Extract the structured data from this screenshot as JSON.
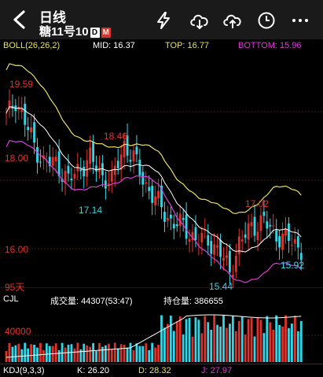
{
  "header": {
    "title": "日线",
    "instrument": "糖11号10",
    "badge_d": "D",
    "badge_m": "M",
    "icons": [
      "back-icon",
      "lightning-icon",
      "cloud-download-icon",
      "cloud-upload-icon",
      "clock-icon",
      "more-icon"
    ]
  },
  "boll": {
    "label": "BOLL(26,26,2)",
    "mid": "MID: 16.37",
    "top": "TOP: 16.77",
    "bottom": "BOTTOM: 15.96"
  },
  "price_axis": {
    "p18": "18.00",
    "p16": "16.00",
    "period": "95天"
  },
  "annotations": {
    "high": "19.59",
    "peak2": "18.46",
    "low1": "17.14",
    "peak3": "17.02",
    "low2": "15.44",
    "last": "15.92"
  },
  "volume": {
    "label": "CJL",
    "volume_text": "成交量: 44307(53:47)",
    "oi_text": "持仓量: 386655",
    "axis": "40000"
  },
  "kdj": {
    "label": "KDJ(9,3,3)",
    "k": "K: 26.20",
    "d": "D: 28.32",
    "j": "J: 27.97"
  },
  "colors": {
    "up": "#e0322a",
    "down": "#33d6e6",
    "mid_line": "#ffffff",
    "top_line": "#e8e05a",
    "bottom_line": "#d83cd8",
    "header_bg": "#1a1a1a"
  }
}
